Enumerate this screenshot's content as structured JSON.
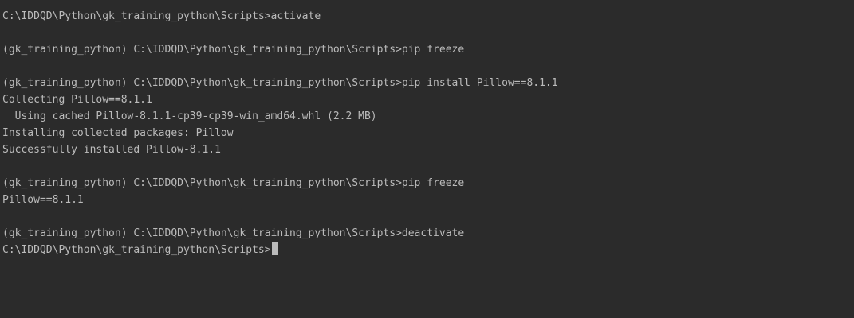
{
  "terminal": {
    "lines": [
      "C:\\IDDQD\\Python\\gk_training_python\\Scripts>activate",
      "",
      "(gk_training_python) C:\\IDDQD\\Python\\gk_training_python\\Scripts>pip freeze",
      "",
      "(gk_training_python) C:\\IDDQD\\Python\\gk_training_python\\Scripts>pip install Pillow==8.1.1",
      "Collecting Pillow==8.1.1",
      "  Using cached Pillow-8.1.1-cp39-cp39-win_amd64.whl (2.2 MB)",
      "Installing collected packages: Pillow",
      "Successfully installed Pillow-8.1.1",
      "",
      "(gk_training_python) C:\\IDDQD\\Python\\gk_training_python\\Scripts>pip freeze",
      "Pillow==8.1.1",
      "",
      "(gk_training_python) C:\\IDDQD\\Python\\gk_training_python\\Scripts>deactivate",
      "C:\\IDDQD\\Python\\gk_training_python\\Scripts>"
    ]
  },
  "colors": {
    "background": "#2b2b2b",
    "text": "#bbbbbb",
    "cursor": "#bbbbbb"
  }
}
